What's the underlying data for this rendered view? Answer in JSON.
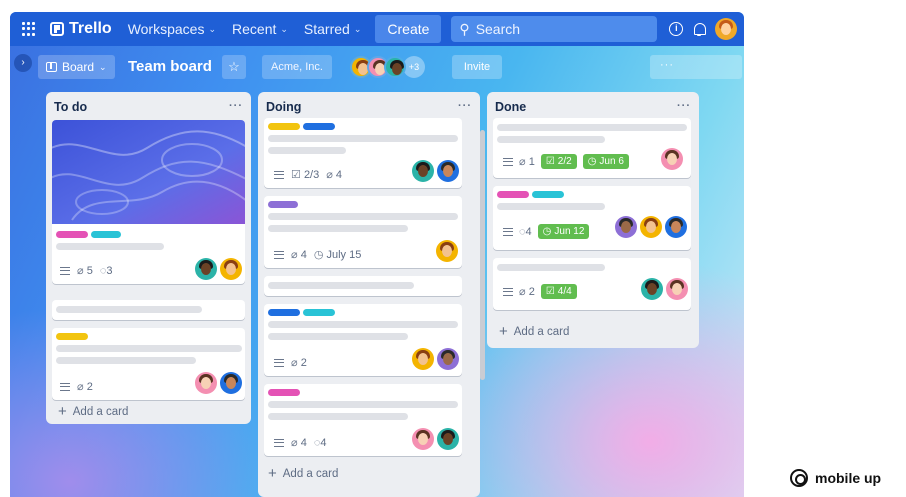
{
  "nav": {
    "app_name": "Trello",
    "workspaces": "Workspaces",
    "recent": "Recent",
    "starred": "Starred",
    "create": "Create",
    "search_placeholder": "Search"
  },
  "board": {
    "view": "Board",
    "title": "Team board",
    "workspace": "Acme, Inc.",
    "members_more": "+3",
    "invite": "Invite",
    "menu": "···"
  },
  "lists": [
    {
      "title": "To do",
      "menu": "···",
      "add_card": "Add a card",
      "cards": [
        {
          "labels": [
            "#e452b5",
            "#29c3d6"
          ],
          "attachments": "5",
          "comments": "3"
        },
        {},
        {
          "labels": [
            "#f2c40f"
          ],
          "attachments": "2"
        }
      ]
    },
    {
      "title": "Doing",
      "menu": "···",
      "add_card": "Add a card",
      "cards": [
        {
          "labels": [
            "#f2c40f",
            "#1f6fe0"
          ],
          "checklist": "2/3",
          "attachments": "4"
        },
        {
          "labels": [
            "#8d6fd6"
          ],
          "attachments": "4",
          "due": "July 15"
        },
        {},
        {
          "labels": [
            "#1f6fe0",
            "#29c3d6"
          ],
          "attachments": "2"
        },
        {
          "labels": [
            "#e452b5"
          ],
          "attachments": "4",
          "comments": "4"
        }
      ]
    },
    {
      "title": "Done",
      "menu": "···",
      "add_card": "Add a card",
      "cards": [
        {
          "attachments": "1",
          "checklist": "2/2",
          "due": "Jun 6"
        },
        {
          "labels": [
            "#e452b5",
            "#29c3d6"
          ],
          "comments": "4",
          "due": "Jun 12"
        },
        {
          "attachments": "2",
          "checklist": "4/4"
        }
      ]
    }
  ],
  "brand": "mobile up",
  "colors": {
    "nav_bg": "#1f5fd6",
    "list_bg": "#eceef2",
    "badge_green": "#61bd4f"
  }
}
